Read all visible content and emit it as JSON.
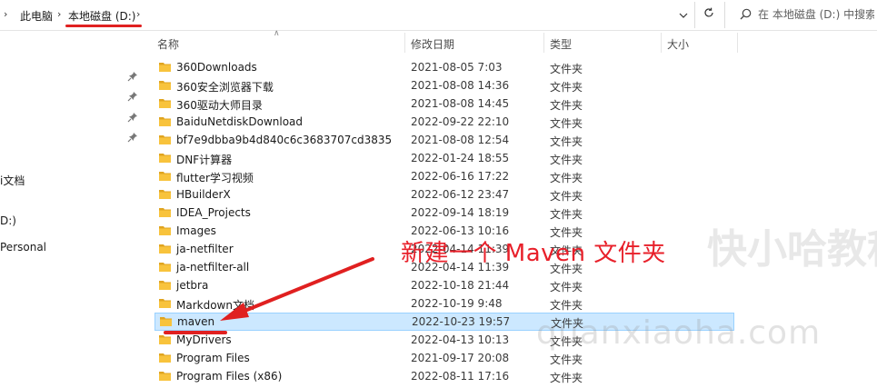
{
  "address_bar": {
    "crumbs": [
      "此电脑",
      "本地磁盘 (D:)"
    ],
    "search_placeholder": "在 本地磁盘 (D:) 中搜索"
  },
  "nav": {
    "labels": [
      "i文档",
      "D:)",
      "Personal"
    ]
  },
  "columns": {
    "name": "名称",
    "date": "修改日期",
    "type": "类型",
    "size": "大小"
  },
  "files": [
    {
      "name": "360Downloads",
      "date": "2021-08-05 7:03",
      "type": "文件夹"
    },
    {
      "name": "360安全浏览器下载",
      "date": "2021-08-08 14:36",
      "type": "文件夹"
    },
    {
      "name": "360驱动大师目录",
      "date": "2021-08-08 14:45",
      "type": "文件夹"
    },
    {
      "name": "BaiduNetdiskDownload",
      "date": "2022-09-22 22:10",
      "type": "文件夹"
    },
    {
      "name": "bf7e9dbba9b4d840c6c3683707cd3835",
      "date": "2021-08-08 12:54",
      "type": "文件夹"
    },
    {
      "name": "DNF计算器",
      "date": "2022-01-24 18:55",
      "type": "文件夹"
    },
    {
      "name": "flutter学习视频",
      "date": "2022-06-16 17:22",
      "type": "文件夹"
    },
    {
      "name": "HBuilderX",
      "date": "2022-06-12 23:47",
      "type": "文件夹"
    },
    {
      "name": "IDEA_Projects",
      "date": "2022-09-14 18:19",
      "type": "文件夹"
    },
    {
      "name": "Images",
      "date": "2022-06-13 10:16",
      "type": "文件夹"
    },
    {
      "name": "ja-netfilter",
      "date": "2022-04-14 11:39",
      "type": "文件夹"
    },
    {
      "name": "ja-netfilter-all",
      "date": "2022-04-14 11:39",
      "type": "文件夹"
    },
    {
      "name": "jetbra",
      "date": "2022-10-18 21:44",
      "type": "文件夹"
    },
    {
      "name": "Markdown文档",
      "date": "2022-10-19 9:48",
      "type": "文件夹"
    },
    {
      "name": "maven",
      "date": "2022-10-23 19:57",
      "type": "文件夹"
    },
    {
      "name": "MyDrivers",
      "date": "2022-04-13 10:13",
      "type": "文件夹"
    },
    {
      "name": "Program Files",
      "date": "2021-09-17 20:08",
      "type": "文件夹"
    },
    {
      "name": "Program Files (x86)",
      "date": "2022-08-11 17:16",
      "type": "文件夹"
    }
  ],
  "annotation": "新建一个 Maven 文件夹",
  "watermark": {
    "cn": "快小哈教程",
    "en": "quanxiaoha.com"
  },
  "colors": {
    "accent_red": "#e02020",
    "selection_bg": "#cce8ff",
    "folder_yellow": "#f8c33c"
  }
}
